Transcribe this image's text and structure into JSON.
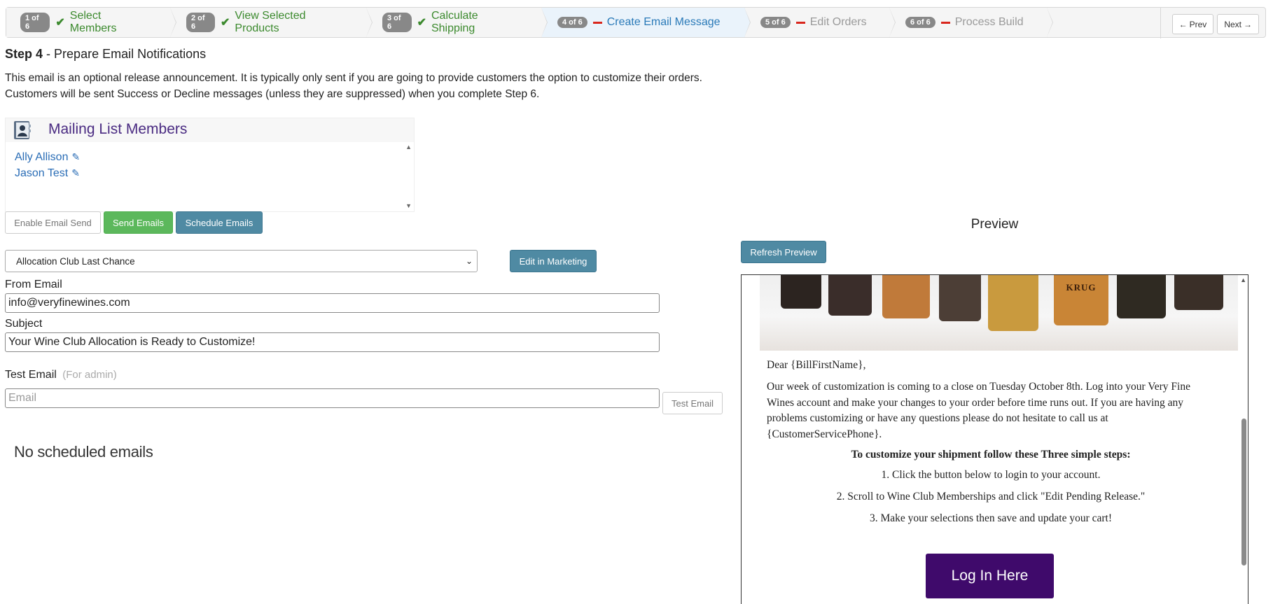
{
  "wizard": {
    "steps": [
      {
        "badge": "1 of 6",
        "label": "Select Members",
        "state": "done"
      },
      {
        "badge": "2 of 6",
        "label": "View Selected Products",
        "state": "done"
      },
      {
        "badge": "3 of 6",
        "label": "Calculate Shipping",
        "state": "done"
      },
      {
        "badge": "4 of 6",
        "label": "Create Email Message",
        "state": "active"
      },
      {
        "badge": "5 of 6",
        "label": "Edit Orders",
        "state": "todo"
      },
      {
        "badge": "6 of 6",
        "label": "Process Build",
        "state": "todo"
      }
    ],
    "prev_label": "Prev",
    "next_label": "Next"
  },
  "page": {
    "step_label": "Step 4",
    "step_title": "- Prepare Email Notifications",
    "desc_line1": "This email is an optional release announcement. It is typically only sent if you are going to provide customers the option to customize their orders.",
    "desc_line2": "Customers will be sent Success or Decline messages (unless they are suppressed) when you complete Step 6."
  },
  "mailing_list": {
    "title": "Mailing List Members",
    "members": [
      "Ally Allison",
      "Jason Test"
    ]
  },
  "actions": {
    "enable_label": "Enable Email Send",
    "send_label": "Send Emails",
    "schedule_label": "Schedule Emails"
  },
  "template": {
    "selected": "Allocation Club Last Chance",
    "edit_label": "Edit in Marketing"
  },
  "form": {
    "from_label": "From Email",
    "from_value": "info@veryfinewines.com",
    "subject_label": "Subject",
    "subject_value": "Your Wine Club Allocation is Ready to Customize!",
    "test_label": "Test Email",
    "test_hint": "(For admin)",
    "test_placeholder": "Email",
    "test_button": "Test Email"
  },
  "scheduled": {
    "empty_text": "No scheduled emails"
  },
  "preview": {
    "title": "Preview",
    "refresh_label": "Refresh Preview",
    "greeting": "Dear {BillFirstName},",
    "paragraph": "Our week of customization is coming to a close on Tuesday October 8th. Log into your Very Fine Wines account and make your changes to your order before time runs out. If you are having any problems customizing or have any questions please do not hesitate to call us at {CustomerServicePhone}.",
    "steps_heading": "To customize your shipment follow these Three simple steps:",
    "steps": [
      "1. Click the button below to login to your account.",
      "2. Scroll to Wine Club Memberships and click \"Edit Pending Release.\"",
      "3. Make your selections then save and update your cart!"
    ],
    "login_label": "Log In Here",
    "bottle_brand": "KRUG"
  },
  "colors": {
    "done": "#3c8a2e",
    "active": "#2a7ab8",
    "todo": "#9a9a9a",
    "todo_dash": "#d9261c",
    "list_title": "#4a2b82",
    "send": "#5cb85c",
    "teal_button": "#4f8aa3",
    "login_button": "#3f0a6b"
  }
}
